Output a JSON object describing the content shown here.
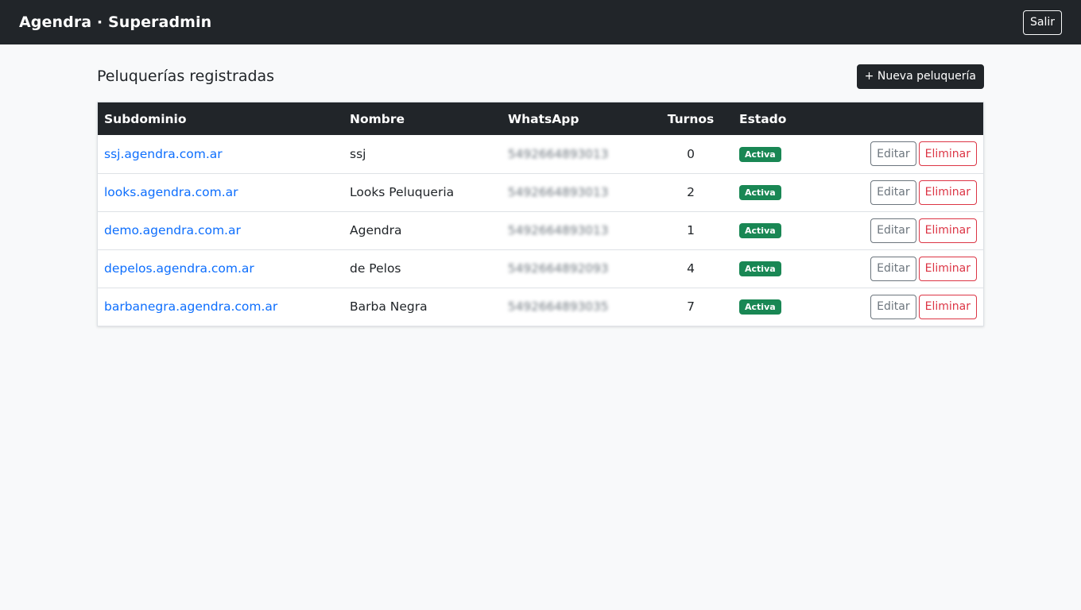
{
  "navbar": {
    "brand": "Agendra · Superadmin",
    "logout_label": "Salir"
  },
  "main": {
    "title": "Peluquerías registradas",
    "new_button_label": "+ Nueva peluquería"
  },
  "table": {
    "headers": {
      "subdominio": "Subdominio",
      "nombre": "Nombre",
      "whatsapp": "WhatsApp",
      "turnos": "Turnos",
      "estado": "Estado"
    },
    "rows": [
      {
        "subdominio": "ssj.agendra.com.ar",
        "nombre": "ssj",
        "whatsapp": "5492664893013",
        "turnos": "0",
        "estado": "Activa",
        "edit": "Editar",
        "delete": "Eliminar"
      },
      {
        "subdominio": "looks.agendra.com.ar",
        "nombre": "Looks Peluqueria",
        "whatsapp": "5492664893013",
        "turnos": "2",
        "estado": "Activa",
        "edit": "Editar",
        "delete": "Eliminar"
      },
      {
        "subdominio": "demo.agendra.com.ar",
        "nombre": "Agendra",
        "whatsapp": "5492664893013",
        "turnos": "1",
        "estado": "Activa",
        "edit": "Editar",
        "delete": "Eliminar"
      },
      {
        "subdominio": "depelos.agendra.com.ar",
        "nombre": "de Pelos",
        "whatsapp": "5492664892093",
        "turnos": "4",
        "estado": "Activa",
        "edit": "Editar",
        "delete": "Eliminar"
      },
      {
        "subdominio": "barbanegra.agendra.com.ar",
        "nombre": "Barba Negra",
        "whatsapp": "5492664893035",
        "turnos": "7",
        "estado": "Activa",
        "edit": "Editar",
        "delete": "Eliminar"
      }
    ]
  },
  "colors": {
    "navbar_bg": "#212529",
    "link": "#0d6efd",
    "badge_success": "#198754",
    "danger": "#dc3545",
    "secondary": "#6c757d"
  }
}
